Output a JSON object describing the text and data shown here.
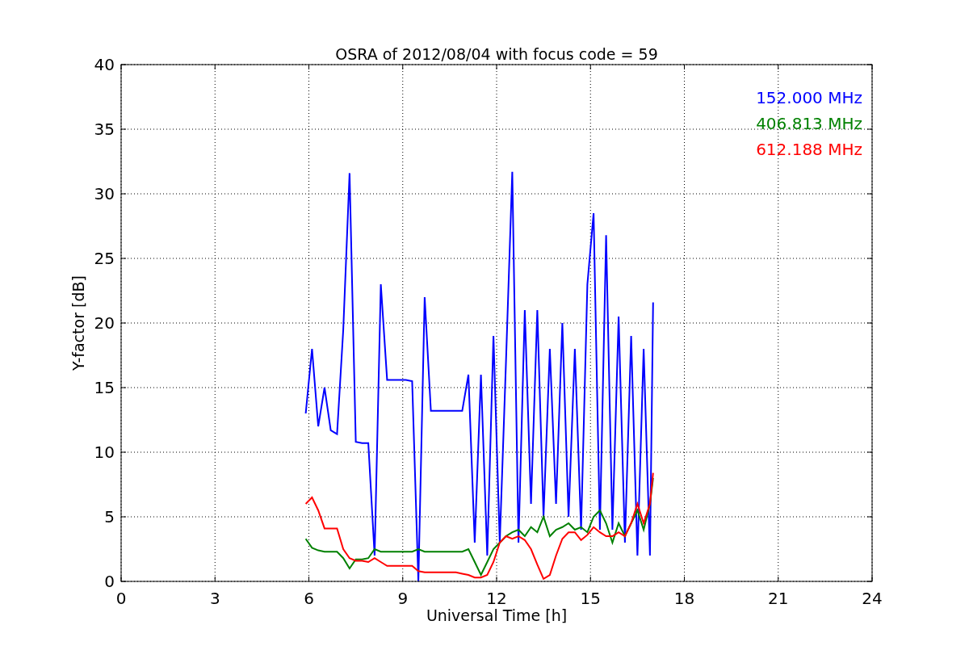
{
  "chart_data": {
    "type": "line",
    "title": "OSRA of 2012/08/04 with focus code = 59",
    "xlabel": "Universal Time [h]",
    "ylabel": "Y-factor [dB]",
    "x": [
      5.9,
      6.1,
      6.3,
      6.5,
      6.7,
      6.9,
      7.1,
      7.3,
      7.5,
      7.7,
      7.9,
      8.1,
      8.3,
      8.5,
      8.7,
      8.9,
      9.1,
      9.3,
      9.5,
      9.7,
      9.9,
      10.1,
      10.3,
      10.5,
      10.7,
      10.9,
      11.1,
      11.3,
      11.5,
      11.7,
      11.9,
      12.1,
      12.3,
      12.5,
      12.7,
      12.9,
      13.1,
      13.3,
      13.5,
      13.7,
      13.9,
      14.1,
      14.3,
      14.5,
      14.7,
      14.9,
      15.1,
      15.3,
      15.5,
      15.7,
      15.9,
      16.1,
      16.3,
      16.5,
      16.7,
      16.9,
      17.0
    ],
    "series": [
      {
        "name": "152.000 MHz",
        "color": "#0000ff",
        "values": [
          13,
          18,
          12,
          15,
          11.7,
          11.4,
          19.5,
          31.6,
          10.8,
          10.7,
          10.7,
          2,
          23,
          15.6,
          15.6,
          15.6,
          15.6,
          15.5,
          0,
          22,
          13.2,
          13.2,
          13.2,
          13.2,
          13.2,
          13.2,
          16,
          3,
          16,
          2,
          19,
          3,
          17,
          31.7,
          3,
          21,
          6,
          21,
          5,
          18,
          6,
          20,
          5,
          18,
          4,
          23,
          28.5,
          4,
          26.8,
          4,
          20.5,
          3,
          19,
          2,
          18,
          2,
          21.6
        ]
      },
      {
        "name": "406.813 MHz",
        "color": "#008000",
        "values": [
          3.3,
          2.6,
          2.4,
          2.3,
          2.3,
          2.3,
          1.8,
          1.0,
          1.7,
          1.7,
          1.8,
          2.5,
          2.3,
          2.3,
          2.3,
          2.3,
          2.3,
          2.3,
          2.5,
          2.3,
          2.3,
          2.3,
          2.3,
          2.3,
          2.3,
          2.3,
          2.5,
          1.5,
          0.5,
          1.5,
          2.5,
          3,
          3.5,
          3.8,
          4,
          3.5,
          4.2,
          3.8,
          5,
          3.5,
          4,
          4.2,
          4.5,
          4,
          4.2,
          3.8,
          5,
          5.5,
          4.5,
          3,
          4.5,
          3.5,
          4.5,
          5.5,
          4,
          6,
          8
        ]
      },
      {
        "name": "612.188 MHz",
        "color": "#ff0000",
        "values": [
          6,
          6.5,
          5.5,
          4.1,
          4.1,
          4.1,
          2.5,
          1.8,
          1.6,
          1.6,
          1.5,
          1.8,
          1.5,
          1.2,
          1.2,
          1.2,
          1.2,
          1.2,
          0.8,
          0.7,
          0.7,
          0.7,
          0.7,
          0.7,
          0.7,
          0.6,
          0.5,
          0.3,
          0.3,
          0.5,
          1.5,
          3,
          3.5,
          3.3,
          3.5,
          3.2,
          2.5,
          1.3,
          0.2,
          0.5,
          2,
          3.3,
          3.8,
          3.8,
          3.2,
          3.6,
          4.2,
          3.8,
          3.5,
          3.5,
          3.8,
          3.5,
          4.5,
          6,
          4.5,
          6,
          8.4
        ]
      }
    ],
    "xlim": [
      0,
      24
    ],
    "ylim": [
      0,
      40
    ],
    "xticks": [
      0,
      3,
      6,
      9,
      12,
      15,
      18,
      21,
      24
    ],
    "yticks": [
      0,
      5,
      10,
      15,
      20,
      25,
      30,
      35,
      40
    ],
    "grid": true
  }
}
